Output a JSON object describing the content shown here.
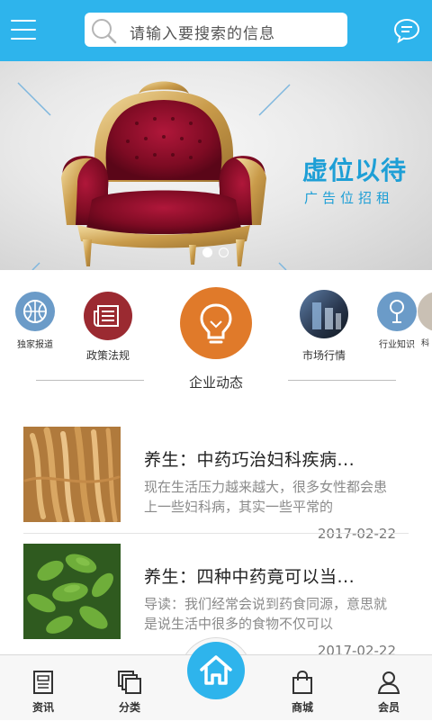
{
  "header": {
    "search_placeholder": "请输入要搜索的信息",
    "accent_color": "#2eb4ec",
    "icons": [
      "menu-icon",
      "search-icon",
      "chat-bubble-icon"
    ]
  },
  "banner": {
    "title": "虚位以待",
    "subtitle": "广告位招租",
    "slides_total": 2,
    "active_slide": 1
  },
  "categories": {
    "items": [
      {
        "label": "独家报道",
        "icon": "basketball-icon"
      },
      {
        "label": "政策法规",
        "icon": "newspaper-icon"
      },
      {
        "label": "企业动态",
        "icon": "lightbulb-icon"
      },
      {
        "label": "市场行情",
        "icon": "market-photo-icon"
      },
      {
        "label": "行业知识",
        "icon": "microphone-icon"
      },
      {
        "label": "科",
        "icon": "partial-icon"
      }
    ],
    "active_label": "企业动态"
  },
  "news": [
    {
      "title": "养生：中药巧治妇科疾病...",
      "desc": "现在生活压力越来越大，很多女性都会患上一些妇科病，其实一些平常的",
      "date": "2017-02-22"
    },
    {
      "title": "养生：四种中药竟可以当...",
      "desc": "导读：我们经常会说到药食同源，意思就是说生活中很多的食物不仅可以",
      "date": "2017-02-22"
    }
  ],
  "tabbar": {
    "tabs": [
      {
        "label": "资讯",
        "icon": "news-icon"
      },
      {
        "label": "分类",
        "icon": "category-icon"
      },
      {
        "label": "",
        "icon": "home-icon"
      },
      {
        "label": "商城",
        "icon": "shopping-bag-icon"
      },
      {
        "label": "会员",
        "icon": "user-icon"
      }
    ]
  }
}
